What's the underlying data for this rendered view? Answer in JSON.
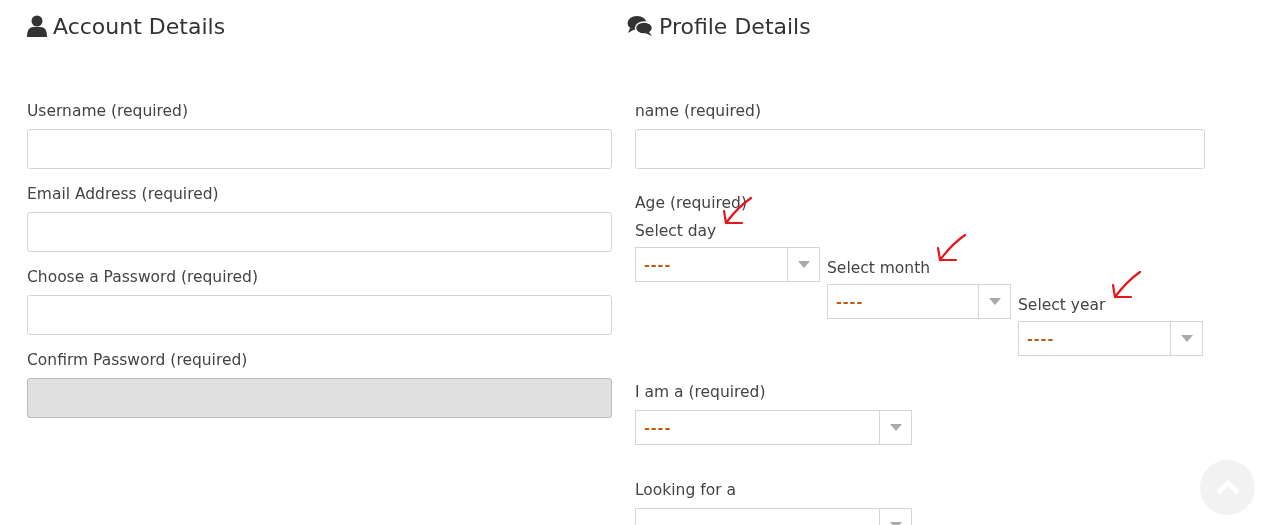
{
  "account": {
    "title": "Account Details",
    "fields": [
      {
        "label": "Username (required)",
        "disabled": false
      },
      {
        "label": "Email Address (required)",
        "disabled": false
      },
      {
        "label": "Choose a Password (required)",
        "disabled": false
      },
      {
        "label": "Confirm Password (required)",
        "disabled": true
      }
    ]
  },
  "profile": {
    "title": "Profile Details",
    "name_field": {
      "label": "name (required)",
      "disabled": false
    },
    "age": {
      "label": "Age (required)",
      "selects": [
        {
          "label": "Select day",
          "value": "----",
          "annotated": true
        },
        {
          "label": "Select month",
          "value": "----",
          "annotated": true
        },
        {
          "label": "Select year",
          "value": "----",
          "annotated": true
        }
      ]
    },
    "i_am": {
      "label": "I am a (required)",
      "value": "----"
    },
    "looking_for": {
      "label": "Looking for a"
    }
  }
}
